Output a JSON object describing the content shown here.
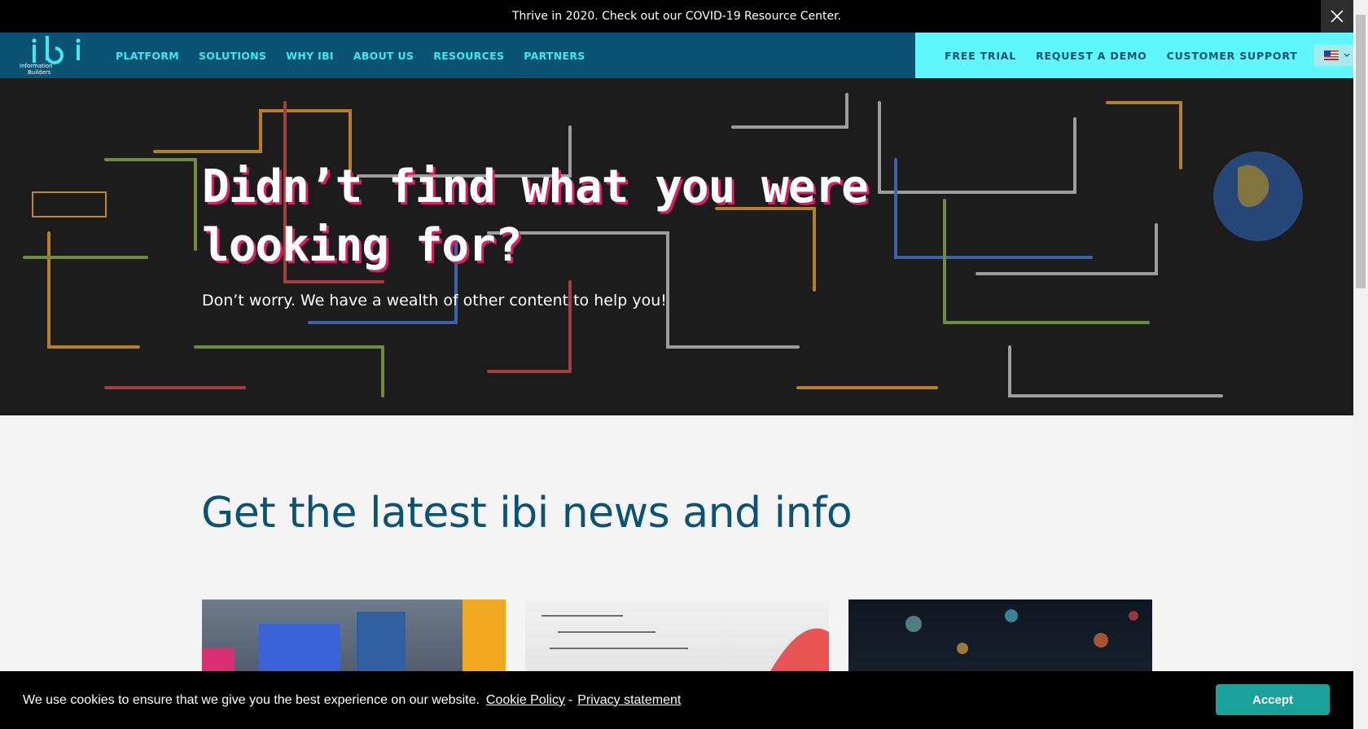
{
  "announcement": {
    "text": "Thrive in 2020. Check out our COVID-19 Resource Center.",
    "close_icon": "close-icon"
  },
  "logo": {
    "mark": "ibi",
    "line1": "Information",
    "line2": "Builders"
  },
  "nav": {
    "main": [
      {
        "label": "PLATFORM"
      },
      {
        "label": "SOLUTIONS"
      },
      {
        "label": "WHY IBI"
      },
      {
        "label": "ABOUT US"
      },
      {
        "label": "RESOURCES"
      },
      {
        "label": "PARTNERS"
      }
    ],
    "secondary": [
      {
        "label": "FREE TRIAL"
      },
      {
        "label": "REQUEST A DEMO"
      },
      {
        "label": "CUSTOMER SUPPORT"
      }
    ],
    "locale_icon": "us-flag-icon",
    "search_icon": "search-icon"
  },
  "hero": {
    "title": "Didn’t find what you were looking for?",
    "subtitle": "Don’t worry. We have a wealth of other content to help you!"
  },
  "section": {
    "title": "Get the latest ibi news and info"
  },
  "cookie": {
    "text": "We use cookies to ensure that we give you the best experience on our website.",
    "policy_link": "Cookie Policy",
    "separator": "-",
    "privacy_link": "Privacy statement",
    "accept_label": "Accept"
  },
  "colors": {
    "brand": "#0b5374",
    "accent": "#41e8f0",
    "highlight": "#5ff7fb",
    "title_shadow": "#d61f69",
    "accept": "#1aa19a"
  }
}
